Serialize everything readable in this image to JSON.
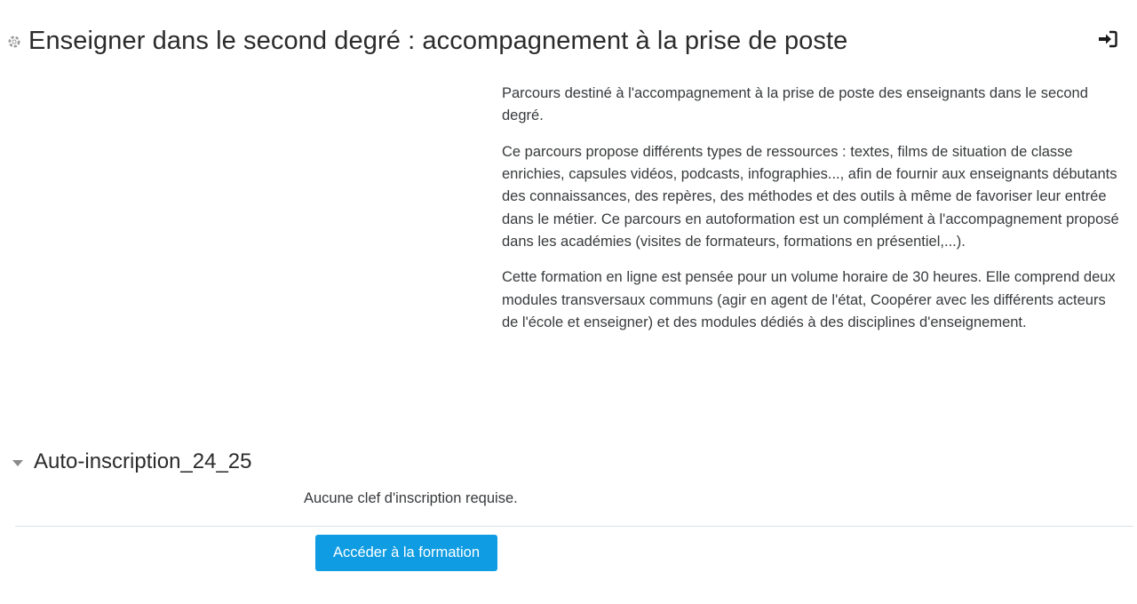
{
  "course": {
    "title": "Enseigner dans le second degré : accompagnement à la prise de poste",
    "icon": "course-gear-icon",
    "enrol_icon": "sign-in-icon"
  },
  "summary": {
    "paragraphs": [
      "Parcours destiné à l'accompagnement à la prise de poste des enseignants dans le second degré.",
      "Ce parcours propose différents types de ressources : textes, films de situation de classe enrichies, capsules vidéos, podcasts, infographies..., afin de fournir aux enseignants débutants des connaissances, des repères, des méthodes et des outils à même de favoriser leur entrée dans le métier. Ce parcours en autoformation est un complément à l'accompagnement proposé dans les académies (visites de formateurs, formations en présentiel,...).",
      "Cette formation en ligne est pensée pour un volume horaire de 30 heures. Elle comprend deux modules transversaux communs (agir en agent de l'état, Coopérer avec les différents acteurs de l'école et enseigner) et des modules dédiés à des disciplines d'enseignement."
    ]
  },
  "enrolment": {
    "section_title": "Auto-inscription_24_25",
    "note": "Aucune clef d'inscription requise.",
    "button_label": "Accéder à la formation",
    "collapse_icon": "caret-down-icon"
  },
  "colors": {
    "button_bg": "#0f9ce2",
    "title_text": "#2b2b2b",
    "body_text": "#373a3c",
    "divider": "#dee2e6"
  }
}
